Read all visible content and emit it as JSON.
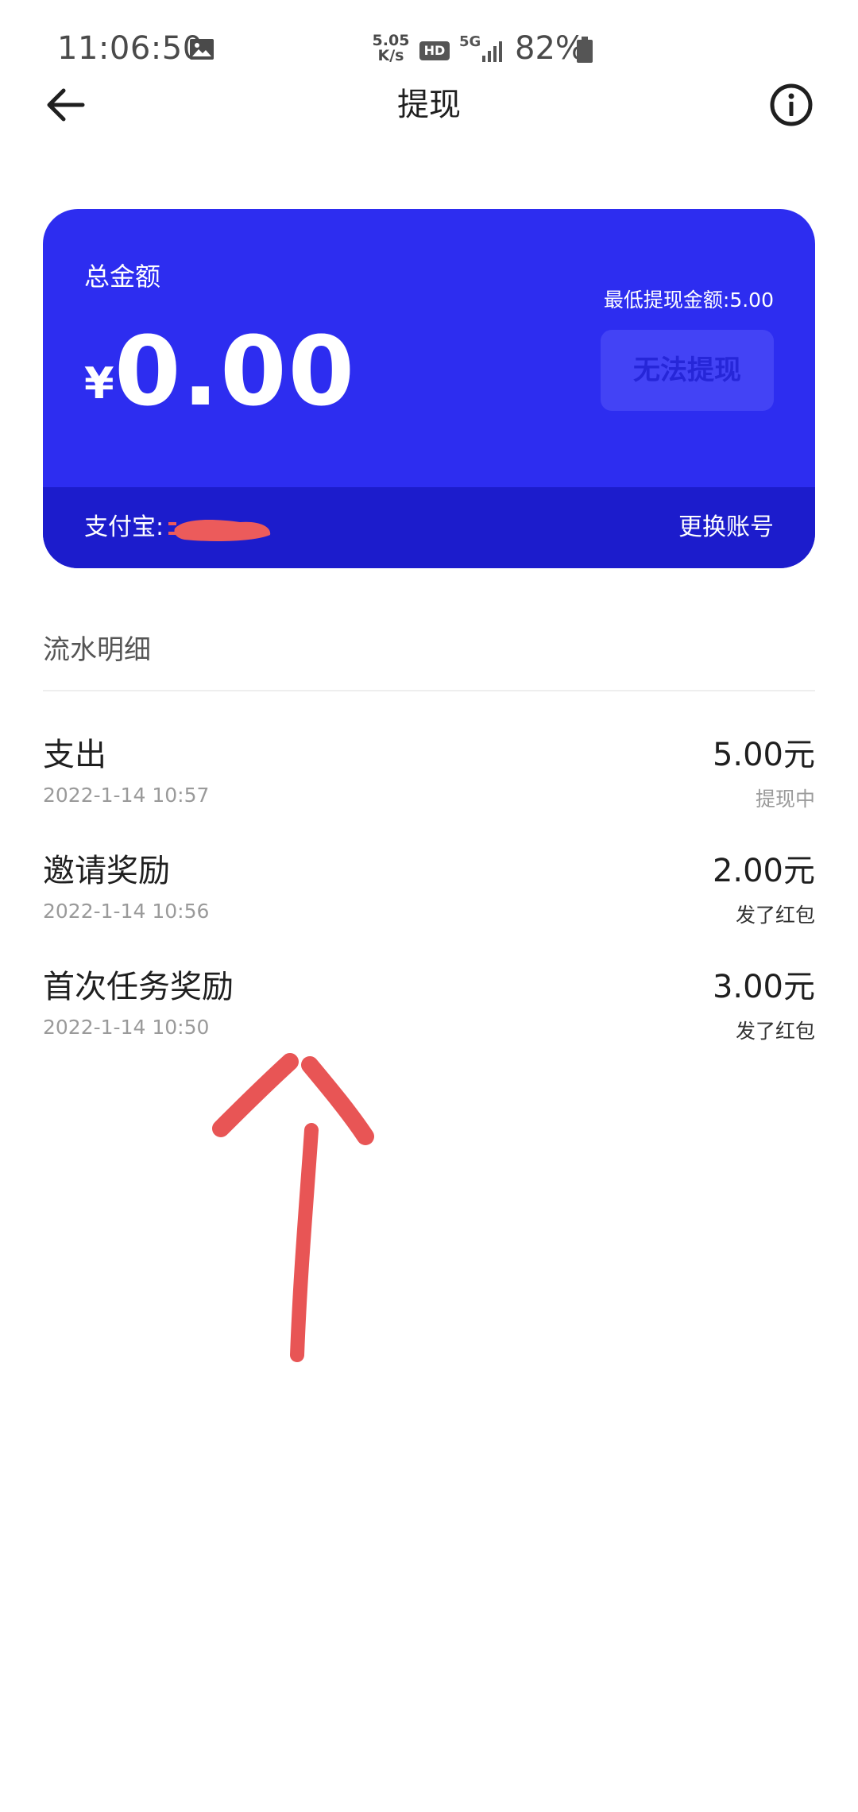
{
  "status_bar": {
    "time": "11:06:50",
    "net_speed_value": "5.05",
    "net_speed_unit": "K/s",
    "hd": "HD",
    "network": "5G",
    "battery": "82%"
  },
  "header": {
    "title": "提现"
  },
  "card": {
    "total_label": "总金额",
    "currency": "¥",
    "amount": "0.00",
    "min_withdraw": "最低提现金额:5.00",
    "withdraw_button": "无法提现",
    "account_label": "支付宝:",
    "change_account": "更换账号",
    "colors": {
      "card_bg": "#2d2df0",
      "footer_bg": "#1c1ccc",
      "disabled_button_bg": "#4343f5",
      "redaction": "#ec5b5b"
    }
  },
  "transactions": {
    "section_title": "流水明细",
    "items": [
      {
        "title": "支出",
        "date": "2022-1-14 10:57",
        "amount": "5.00元",
        "status": "提现中"
      },
      {
        "title": "邀请奖励",
        "date": "2022-1-14 10:56",
        "amount": "2.00元",
        "status": "发了红包"
      },
      {
        "title": "首次任务奖励",
        "date": "2022-1-14 10:50",
        "amount": "3.00元",
        "status": "发了红包"
      }
    ]
  },
  "annotation": {
    "shape": "hand-drawn-arrow-up",
    "color": "#e85555"
  }
}
